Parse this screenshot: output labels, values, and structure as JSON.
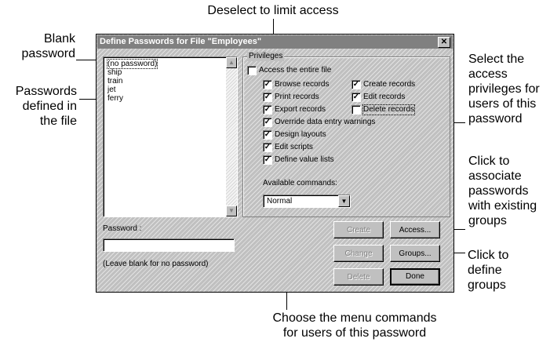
{
  "callouts": {
    "top": "Deselect to limit access",
    "blank_password": "Blank\npassword",
    "passwords_defined": "Passwords\ndefined in\nthe file",
    "select_privileges": "Select the\naccess\nprivileges for\nusers of this\npassword",
    "click_associate": "Click to\nassociate\npasswords\nwith existing\ngroups",
    "click_define": "Click to\ndefine\ngroups",
    "bottom": "Choose the menu commands\nfor users of this password"
  },
  "dialog": {
    "title": "Define Passwords for File \"Employees\"",
    "close_label": "✕",
    "passwords": [
      "(no password)",
      "ship",
      "train",
      "jet",
      "ferry"
    ],
    "privileges_label": "Privileges",
    "access_entire_file": "Access the entire file",
    "privileges": [
      {
        "label": "Browse records",
        "checked": true
      },
      {
        "label": "Create records",
        "checked": true
      },
      {
        "label": "Print records",
        "checked": true
      },
      {
        "label": "Edit records",
        "checked": true
      },
      {
        "label": "Export records",
        "checked": true
      },
      {
        "label": "Delete records",
        "checked": false
      },
      {
        "label": "Override data entry warnings",
        "checked": true
      },
      {
        "label": "Design layouts",
        "checked": true
      },
      {
        "label": "Edit scripts",
        "checked": true
      },
      {
        "label": "Define value lists",
        "checked": true
      }
    ],
    "available_commands_label": "Available commands:",
    "available_commands_value": "Normal",
    "password_label": "Password :",
    "password_value": "",
    "leave_blank_hint": "(Leave blank for no password)",
    "buttons": {
      "create": "Create",
      "change": "Change",
      "delete": "Delete",
      "access": "Access...",
      "groups": "Groups...",
      "done": "Done"
    }
  }
}
